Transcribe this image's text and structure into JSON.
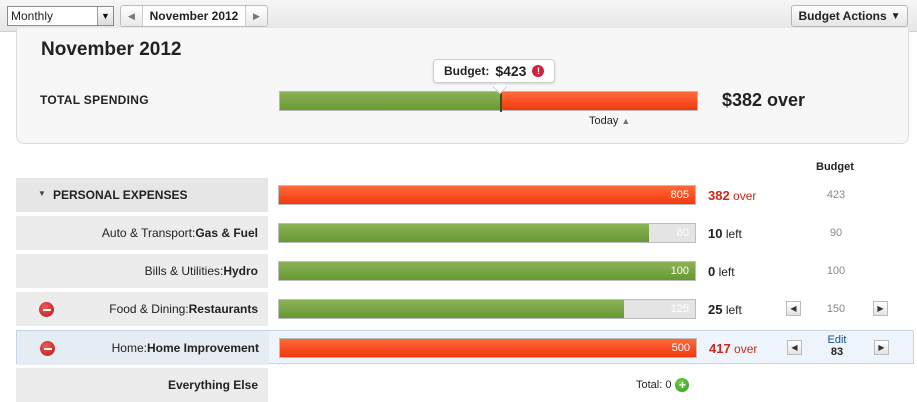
{
  "toolbar": {
    "period": "Monthly",
    "month": "November 2012",
    "budget_actions": "Budget Actions"
  },
  "summary": {
    "title": "November 2012",
    "total_label": "TOTAL SPENDING",
    "budget_label": "Budget:",
    "budget_amount": "$423",
    "over_text": "$382 over",
    "today_label": "Today",
    "budget_fraction": 0.53
  },
  "table": {
    "budget_header": "Budget",
    "group": {
      "label": "PERSONAL EXPENSES",
      "spent": "805",
      "status_num": "382",
      "status_word": "over",
      "budget": "423",
      "fill_fraction": 1.0
    },
    "rows": [
      {
        "category": "Auto & Transport:",
        "sub": "Gas & Fuel",
        "spent": "80",
        "status_num": "10",
        "status_word": "left",
        "budget": "90",
        "fill_fraction": 0.89,
        "color": "green"
      },
      {
        "category": "Bills & Utilities:",
        "sub": "Hydro",
        "spent": "100",
        "status_num": "0",
        "status_word": "left",
        "budget": "100",
        "fill_fraction": 1.0,
        "color": "green"
      },
      {
        "category": "Food & Dining:",
        "sub": "Restaurants",
        "spent": "125",
        "status_num": "25",
        "status_word": "left",
        "budget": "150",
        "fill_fraction": 0.83,
        "color": "green"
      },
      {
        "category": "Home:",
        "sub": "Home Improvement",
        "spent": "500",
        "status_num": "417",
        "status_word": "over",
        "edit_label": "Edit",
        "budget": "83",
        "fill_fraction": 1.0,
        "color": "red"
      }
    ],
    "else_row": {
      "label": "Everything Else",
      "total_label": "Total: 0"
    }
  },
  "colors": {
    "green": "#6a9a34",
    "red": "#f03a10",
    "link": "#1b4e9a"
  },
  "icons": [
    "dropdown-arrow-icon",
    "chevron-left-icon",
    "chevron-right-icon",
    "caret-down-icon",
    "alert-icon",
    "chevron-up-icon",
    "expand-caret-icon",
    "remove-icon",
    "add-icon"
  ]
}
